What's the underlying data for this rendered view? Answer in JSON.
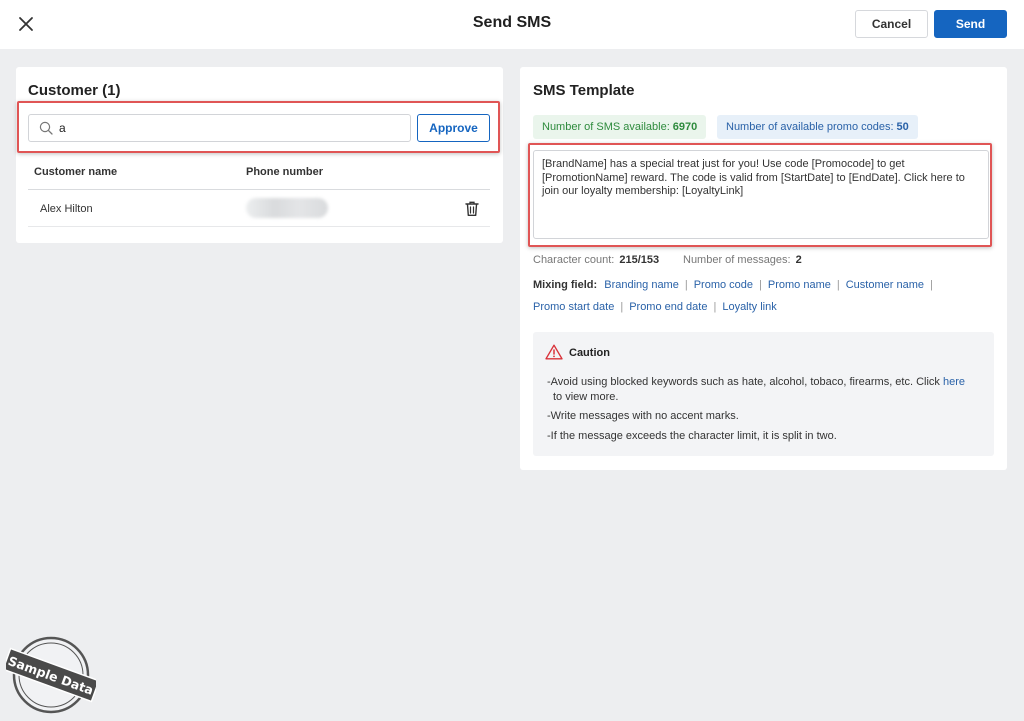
{
  "header": {
    "title": "Send SMS",
    "cancel_label": "Cancel",
    "send_label": "Send"
  },
  "customer_panel": {
    "title": "Customer (1)",
    "search": {
      "value": "a",
      "placeholder": ""
    },
    "approve_label": "Approve",
    "columns": [
      "Customer name",
      "Phone number"
    ],
    "rows": [
      {
        "name": "Alex Hilton",
        "phone": ""
      }
    ]
  },
  "sms_panel": {
    "title": "SMS Template",
    "sms_available_label": "Number of SMS available:",
    "sms_available_value": "6970",
    "promo_available_label": "Number of available promo codes:",
    "promo_available_value": "50",
    "template_text": "[BrandName] has a special treat just for you! Use code [Promocode] to get [PromotionName] reward. The code is valid from [StartDate] to [EndDate]. Click here to join our loyalty membership: [LoyaltyLink]",
    "char_count_label": "Character count:",
    "char_count_value": "215/153",
    "msg_count_label": "Number of messages:",
    "msg_count_value": "2",
    "mixing_label": "Mixing field:",
    "mixing_fields": [
      "Branding name",
      "Promo code",
      "Promo name",
      "Customer name",
      "Promo start date",
      "Promo end date",
      "Loyalty link"
    ],
    "caution": {
      "title": "Caution",
      "item1_text": "-Avoid using blocked keywords such as hate, alcohol, tobaco, firearms, etc. Click",
      "item1_link": "here",
      "item1_tail": "to view more.",
      "item2": "-Write messages with no accent marks.",
      "item3": "-If the message exceeds the character limit, it is split in two."
    }
  },
  "watermark": {
    "text": "Sample Data"
  },
  "icons": {
    "close": "close-icon",
    "search": "search-icon",
    "trash": "trash-icon",
    "warning": "warning-icon"
  },
  "colors": {
    "primary": "#1565c0",
    "highlight": "#e05555",
    "sms_tag_text": "#2e8b3d",
    "promo_tag_text": "#2a62a8",
    "warning": "#d9323a"
  }
}
